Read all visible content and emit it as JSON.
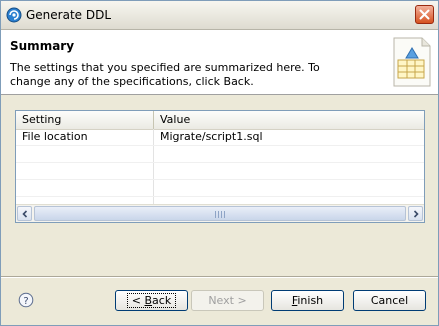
{
  "window": {
    "title": "Generate DDL"
  },
  "banner": {
    "title": "Summary",
    "description": "The settings that you specified are summarized here. To change any of the specifications, click Back."
  },
  "table": {
    "columns": [
      "Setting",
      "Value"
    ],
    "rows": [
      {
        "setting": "File location",
        "value": "Migrate/script1.sql"
      },
      {
        "setting": "",
        "value": ""
      },
      {
        "setting": "",
        "value": ""
      },
      {
        "setting": "",
        "value": ""
      },
      {
        "setting": "",
        "value": ""
      }
    ]
  },
  "buttons": {
    "back_prefix": "< ",
    "back_mnemonic": "B",
    "back_rest": "ack",
    "next": "Next >",
    "finish_mnemonic": "F",
    "finish_rest": "inish",
    "cancel": "Cancel"
  },
  "icons": {
    "title": "app-icon",
    "close": "close-icon",
    "banner": "table-wizard-icon",
    "help": "help-icon"
  }
}
